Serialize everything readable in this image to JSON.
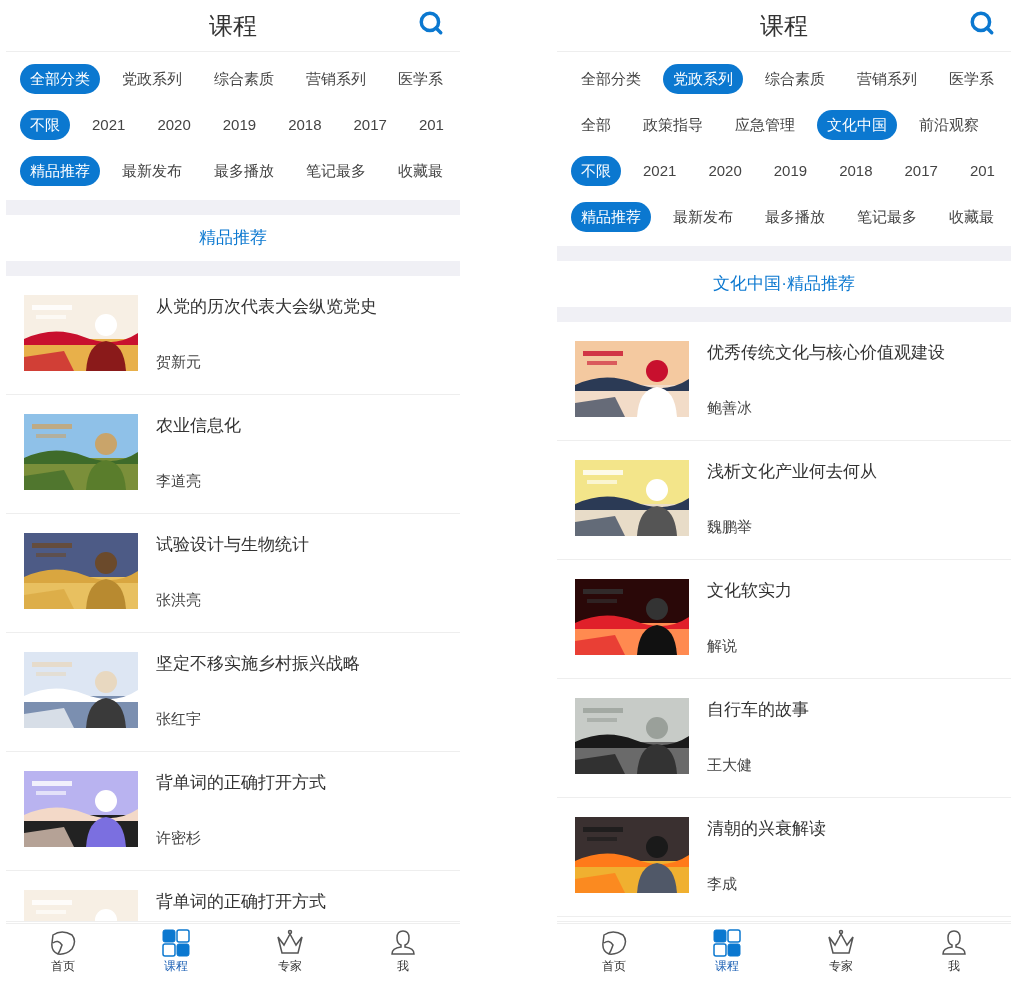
{
  "screens": [
    {
      "title": "课程",
      "filter_rows": [
        [
          {
            "label": "全部分类",
            "selected": true
          },
          {
            "label": "党政系列",
            "selected": false
          },
          {
            "label": "综合素质",
            "selected": false
          },
          {
            "label": "营销系列",
            "selected": false
          },
          {
            "label": "医学系",
            "selected": false
          }
        ],
        [
          {
            "label": "不限",
            "selected": true
          },
          {
            "label": "2021",
            "selected": false
          },
          {
            "label": "2020",
            "selected": false
          },
          {
            "label": "2019",
            "selected": false
          },
          {
            "label": "2018",
            "selected": false
          },
          {
            "label": "2017",
            "selected": false
          },
          {
            "label": "201",
            "selected": false
          }
        ],
        [
          {
            "label": "精品推荐",
            "selected": true
          },
          {
            "label": "最新发布",
            "selected": false
          },
          {
            "label": "最多播放",
            "selected": false
          },
          {
            "label": "笔记最多",
            "selected": false
          },
          {
            "label": "收藏最",
            "selected": false
          }
        ]
      ],
      "section_title": "精品推荐",
      "courses": [
        {
          "title": "从党的历次代表大会纵览党史",
          "author": "贺新元"
        },
        {
          "title": "农业信息化",
          "author": "李道亮"
        },
        {
          "title": "试验设计与生物统计",
          "author": "张洪亮"
        },
        {
          "title": "坚定不移实施乡村振兴战略",
          "author": "张红宇"
        },
        {
          "title": "背单词的正确打开方式",
          "author": "许密杉"
        },
        {
          "title": "背单词的正确打开方式"
        }
      ],
      "nav_items": [
        {
          "label": "首页",
          "selected": false
        },
        {
          "label": "课程",
          "selected": true
        },
        {
          "label": "专家",
          "selected": false
        },
        {
          "label": "我",
          "selected": false
        }
      ]
    },
    {
      "title": "课程",
      "filter_rows": [
        [
          {
            "label": "全部分类",
            "selected": false
          },
          {
            "label": "党政系列",
            "selected": true
          },
          {
            "label": "综合素质",
            "selected": false
          },
          {
            "label": "营销系列",
            "selected": false
          },
          {
            "label": "医学系",
            "selected": false
          }
        ],
        [
          {
            "label": "全部",
            "selected": false
          },
          {
            "label": "政策指导",
            "selected": false
          },
          {
            "label": "应急管理",
            "selected": false
          },
          {
            "label": "文化中国",
            "selected": true
          },
          {
            "label": "前沿观察",
            "selected": false
          }
        ],
        [
          {
            "label": "不限",
            "selected": true
          },
          {
            "label": "2021",
            "selected": false
          },
          {
            "label": "2020",
            "selected": false
          },
          {
            "label": "2019",
            "selected": false
          },
          {
            "label": "2018",
            "selected": false
          },
          {
            "label": "2017",
            "selected": false
          },
          {
            "label": "201",
            "selected": false
          }
        ],
        [
          {
            "label": "精品推荐",
            "selected": true
          },
          {
            "label": "最新发布",
            "selected": false
          },
          {
            "label": "最多播放",
            "selected": false
          },
          {
            "label": "笔记最多",
            "selected": false
          },
          {
            "label": "收藏最",
            "selected": false
          }
        ]
      ],
      "section_title": "文化中国·精品推荐",
      "courses": [
        {
          "title": "优秀传统文化与核心价值观建设",
          "author": "鲍善冰"
        },
        {
          "title": "浅析文化产业何去何从",
          "author": "魏鹏举"
        },
        {
          "title": "文化软实力",
          "author": "解说"
        },
        {
          "title": "自行车的故事",
          "author": "王大健"
        },
        {
          "title": "清朝的兴衰解读",
          "author": "李成"
        }
      ],
      "nav_items": [
        {
          "label": "首页",
          "selected": false
        },
        {
          "label": "课程",
          "selected": true
        },
        {
          "label": "专家",
          "selected": false
        },
        {
          "label": "我",
          "selected": false
        }
      ]
    }
  ]
}
